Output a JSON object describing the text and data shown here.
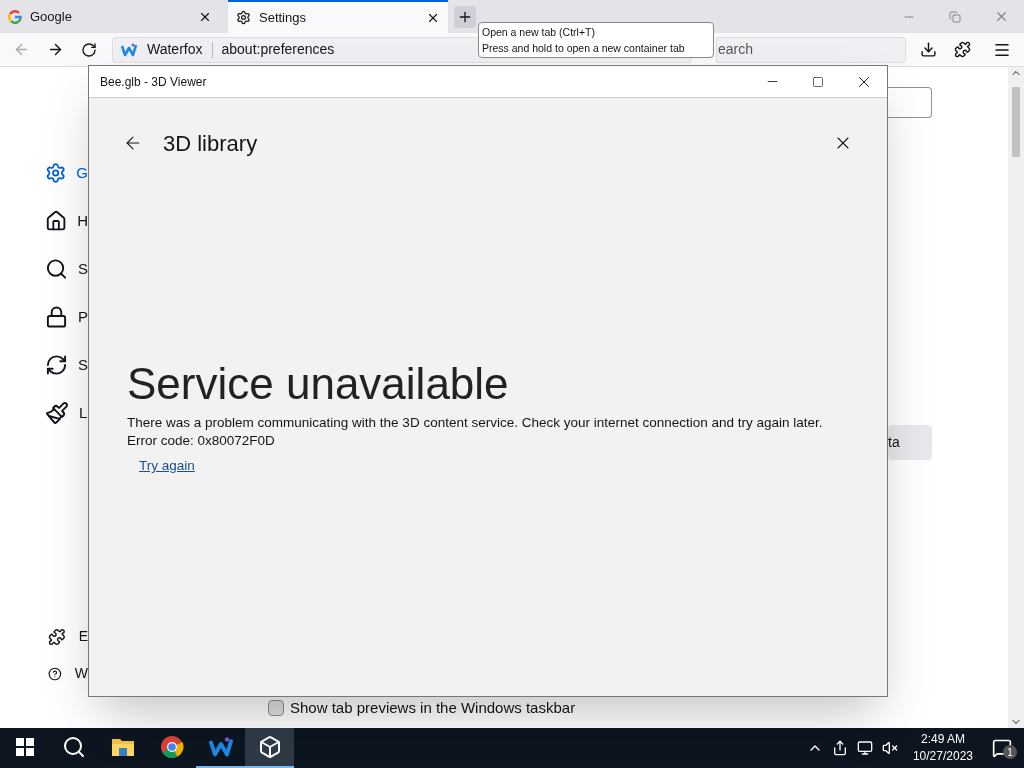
{
  "browser": {
    "tabs": [
      {
        "title": "Google",
        "kind": "google",
        "selected": false
      },
      {
        "title": "Settings",
        "kind": "gear",
        "selected": true
      }
    ],
    "tooltip": {
      "lines": [
        "Open a new tab (Ctrl+T)",
        "Press and hold to open a new container tab"
      ]
    },
    "address_bar": {
      "identity": "Waterfox",
      "url": "about:preferences"
    },
    "search_bar": {
      "text": "earch"
    },
    "settings_page": {
      "sidebar": {
        "items": [
          {
            "label": "G",
            "kind": "gear",
            "selected": true
          },
          {
            "label": "H",
            "kind": "home",
            "selected": false
          },
          {
            "label": "S",
            "kind": "search",
            "selected": false
          },
          {
            "label": "P",
            "kind": "lock",
            "selected": false
          },
          {
            "label": "S",
            "kind": "sync",
            "selected": false
          },
          {
            "label": "L",
            "kind": "brush",
            "selected": false
          }
        ],
        "footer_items": [
          {
            "label": "E",
            "kind": "puzzle"
          },
          {
            "label": "W",
            "kind": "help"
          }
        ]
      },
      "button_label": "ta",
      "checkbox": {
        "label": "Show tab previews in the Windows taskbar",
        "checked": false
      }
    }
  },
  "viewer_window": {
    "title": "Bee.glb - 3D Viewer",
    "header": "3D library",
    "error": {
      "title": "Service unavailable",
      "message": "There was a problem communicating with the 3D content service. Check your internet connection and try again later.",
      "code": "Error code: 0x80072F0D",
      "link": "Try again"
    }
  },
  "taskbar": {
    "apps": [
      {
        "kind": "start",
        "running": false,
        "active": false
      },
      {
        "kind": "search",
        "running": false,
        "active": false
      },
      {
        "kind": "folder",
        "running": false,
        "active": false
      },
      {
        "kind": "chrome",
        "running": false,
        "active": false
      },
      {
        "kind": "waterfox",
        "running": true,
        "active": false
      },
      {
        "kind": "viewer",
        "running": true,
        "active": true
      }
    ],
    "time": "2:49 AM",
    "date": "10/27/2023",
    "notifications": "1"
  }
}
